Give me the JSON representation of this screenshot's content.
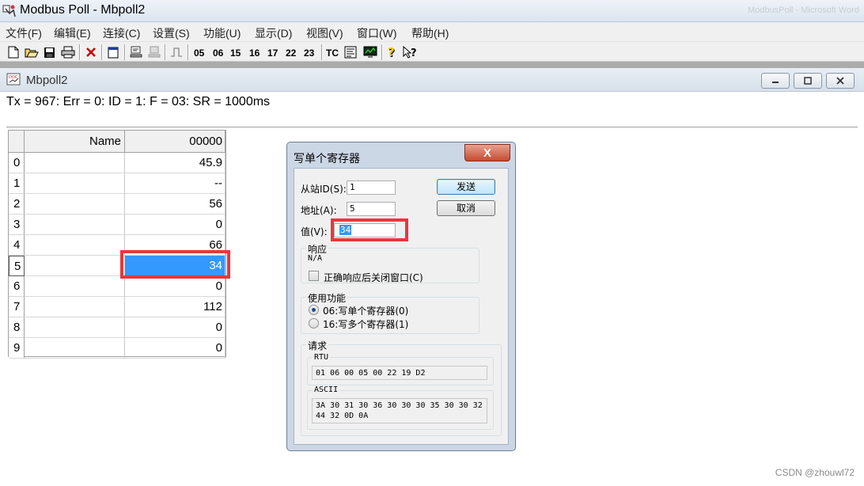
{
  "window": {
    "title": "Modbus Poll - Mbpoll2",
    "background_title": "ModbusPoll - Microsoft Word"
  },
  "menu": [
    "文件(F)",
    "编辑(E)",
    "连接(C)",
    "设置(S)",
    "功能(U)",
    "显示(D)",
    "视图(V)",
    "窗口(W)",
    "帮助(H)"
  ],
  "toolbar": {
    "function_codes": [
      "05",
      "06",
      "15",
      "16",
      "17",
      "22",
      "23"
    ],
    "tc_label": "TC",
    "icons": [
      "new-icon",
      "open-icon",
      "save-icon",
      "print-icon",
      "delete-icon",
      "window-icon",
      "connect-icon",
      "disconnect-icon",
      "pulse-icon",
      "monitor-icon",
      "help-icon",
      "context-help-icon"
    ]
  },
  "child_window": {
    "title": "Mbpoll2",
    "status": "Tx = 967: Err = 0: ID = 1: F = 03: SR = 1000ms"
  },
  "grid": {
    "headers": [
      "Name",
      "00000"
    ],
    "rows": [
      {
        "index": "0",
        "name": "",
        "value": "45.9"
      },
      {
        "index": "1",
        "name": "",
        "value": "--"
      },
      {
        "index": "2",
        "name": "",
        "value": "56"
      },
      {
        "index": "3",
        "name": "",
        "value": "0"
      },
      {
        "index": "4",
        "name": "",
        "value": "66"
      },
      {
        "index": "5",
        "name": "",
        "value": "34"
      },
      {
        "index": "6",
        "name": "",
        "value": "0"
      },
      {
        "index": "7",
        "name": "",
        "value": "112"
      },
      {
        "index": "8",
        "name": "",
        "value": "0"
      },
      {
        "index": "9",
        "name": "",
        "value": "0"
      }
    ],
    "selected_row": 5
  },
  "dialog": {
    "title": "写单个寄存器",
    "close_label": "X",
    "slave_id_label": "从站ID(S):",
    "slave_id_value": "1",
    "address_label": "地址(A):",
    "address_value": "5",
    "value_label": "值(V):",
    "value_value": "34",
    "send_label": "发送",
    "cancel_label": "取消",
    "response_group": "响应",
    "response_text": "N/A",
    "close_on_ok_label": "正确响应后关闭窗口(C)",
    "function_group": "使用功能",
    "func06_label": "06:写单个寄存器(0)",
    "func16_label": "16:写多个寄存器(1)",
    "request_group": "请求",
    "rtu_label": "RTU",
    "rtu_value": "01 06 00 05 00 22 19 D2",
    "ascii_label": "ASCII",
    "ascii_line1": "3A 30 31 30 36 30 30 30 35 30 30 32",
    "ascii_line2": "44 32 0D 0A"
  },
  "watermark": "CSDN @zhouwl72",
  "colors": {
    "highlight": "#3399ff",
    "annotation_red": "#e8373d",
    "dialog_frame": "#ccd7e6"
  }
}
